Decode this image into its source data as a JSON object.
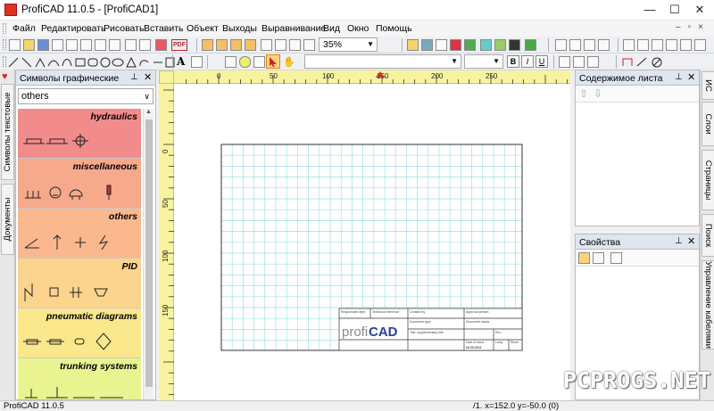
{
  "window": {
    "title": "ProfiCAD 11.0.5 - [ProfiCAD1]",
    "minimize": "—",
    "maximize": "☐",
    "close": "✕"
  },
  "menu": [
    "Файл",
    "Редактировать",
    "Рисовать",
    "Вставить",
    "Объект",
    "Выходы",
    "Выравнивание",
    "Вид",
    "Окно",
    "Помощь"
  ],
  "toolbar": {
    "zoom": "35%",
    "pdf_label": "PDF",
    "text_tool": "A",
    "bold": "B",
    "italic": "I",
    "underline": "U"
  },
  "left_tabs": [
    "Символы текстовые",
    "Документы"
  ],
  "symbols_panel": {
    "title": "Символы графические",
    "pin": "⊥",
    "close": "✕",
    "category": "others",
    "groups": [
      {
        "name": "hydraulics",
        "color": "#f28b8b"
      },
      {
        "name": "miscellaneous",
        "color": "#f7a98c"
      },
      {
        "name": "others",
        "color": "#fbb88e"
      },
      {
        "name": "PID",
        "color": "#fcd48d"
      },
      {
        "name": "pneumatic diagrams",
        "color": "#fbe78c"
      },
      {
        "name": "trunking systems",
        "color": "#e9f490"
      }
    ]
  },
  "ruler": {
    "top_labels": [
      "0",
      "50",
      "100",
      "150",
      "200",
      "250"
    ],
    "left_labels": [
      "0",
      "50",
      "100",
      "150"
    ]
  },
  "title_block": {
    "logo_profi": "profi",
    "logo_cad": "CAD",
    "date": "03.03.2021",
    "cells": [
      "Responsible dept",
      "Technical reference",
      "Created by",
      "Approval person",
      "Document type",
      "Document status",
      "Title, supplementary title",
      "Rev.",
      "Date of issue",
      "Lang.",
      "Sheet"
    ]
  },
  "right_panels": {
    "content_title": "Содержимое листа",
    "props_title": "Свойства",
    "pin": "⊥",
    "close": "✕"
  },
  "right_tabs": [
    "ИС",
    "Слои",
    "Страницы",
    "Поиск",
    "Управление кабелями"
  ],
  "status": {
    "left": "ProfiCAD 11.0.5",
    "coords": "/1.  x=152.0  y=-50.0 (0)"
  },
  "watermark": "PCPROGS.NET",
  "colors": {
    "ruler": "#f7f3a0",
    "grid": "#9edfe8",
    "panel_header": "#dfe6f0",
    "logo_cad": "#2a3f9e"
  }
}
